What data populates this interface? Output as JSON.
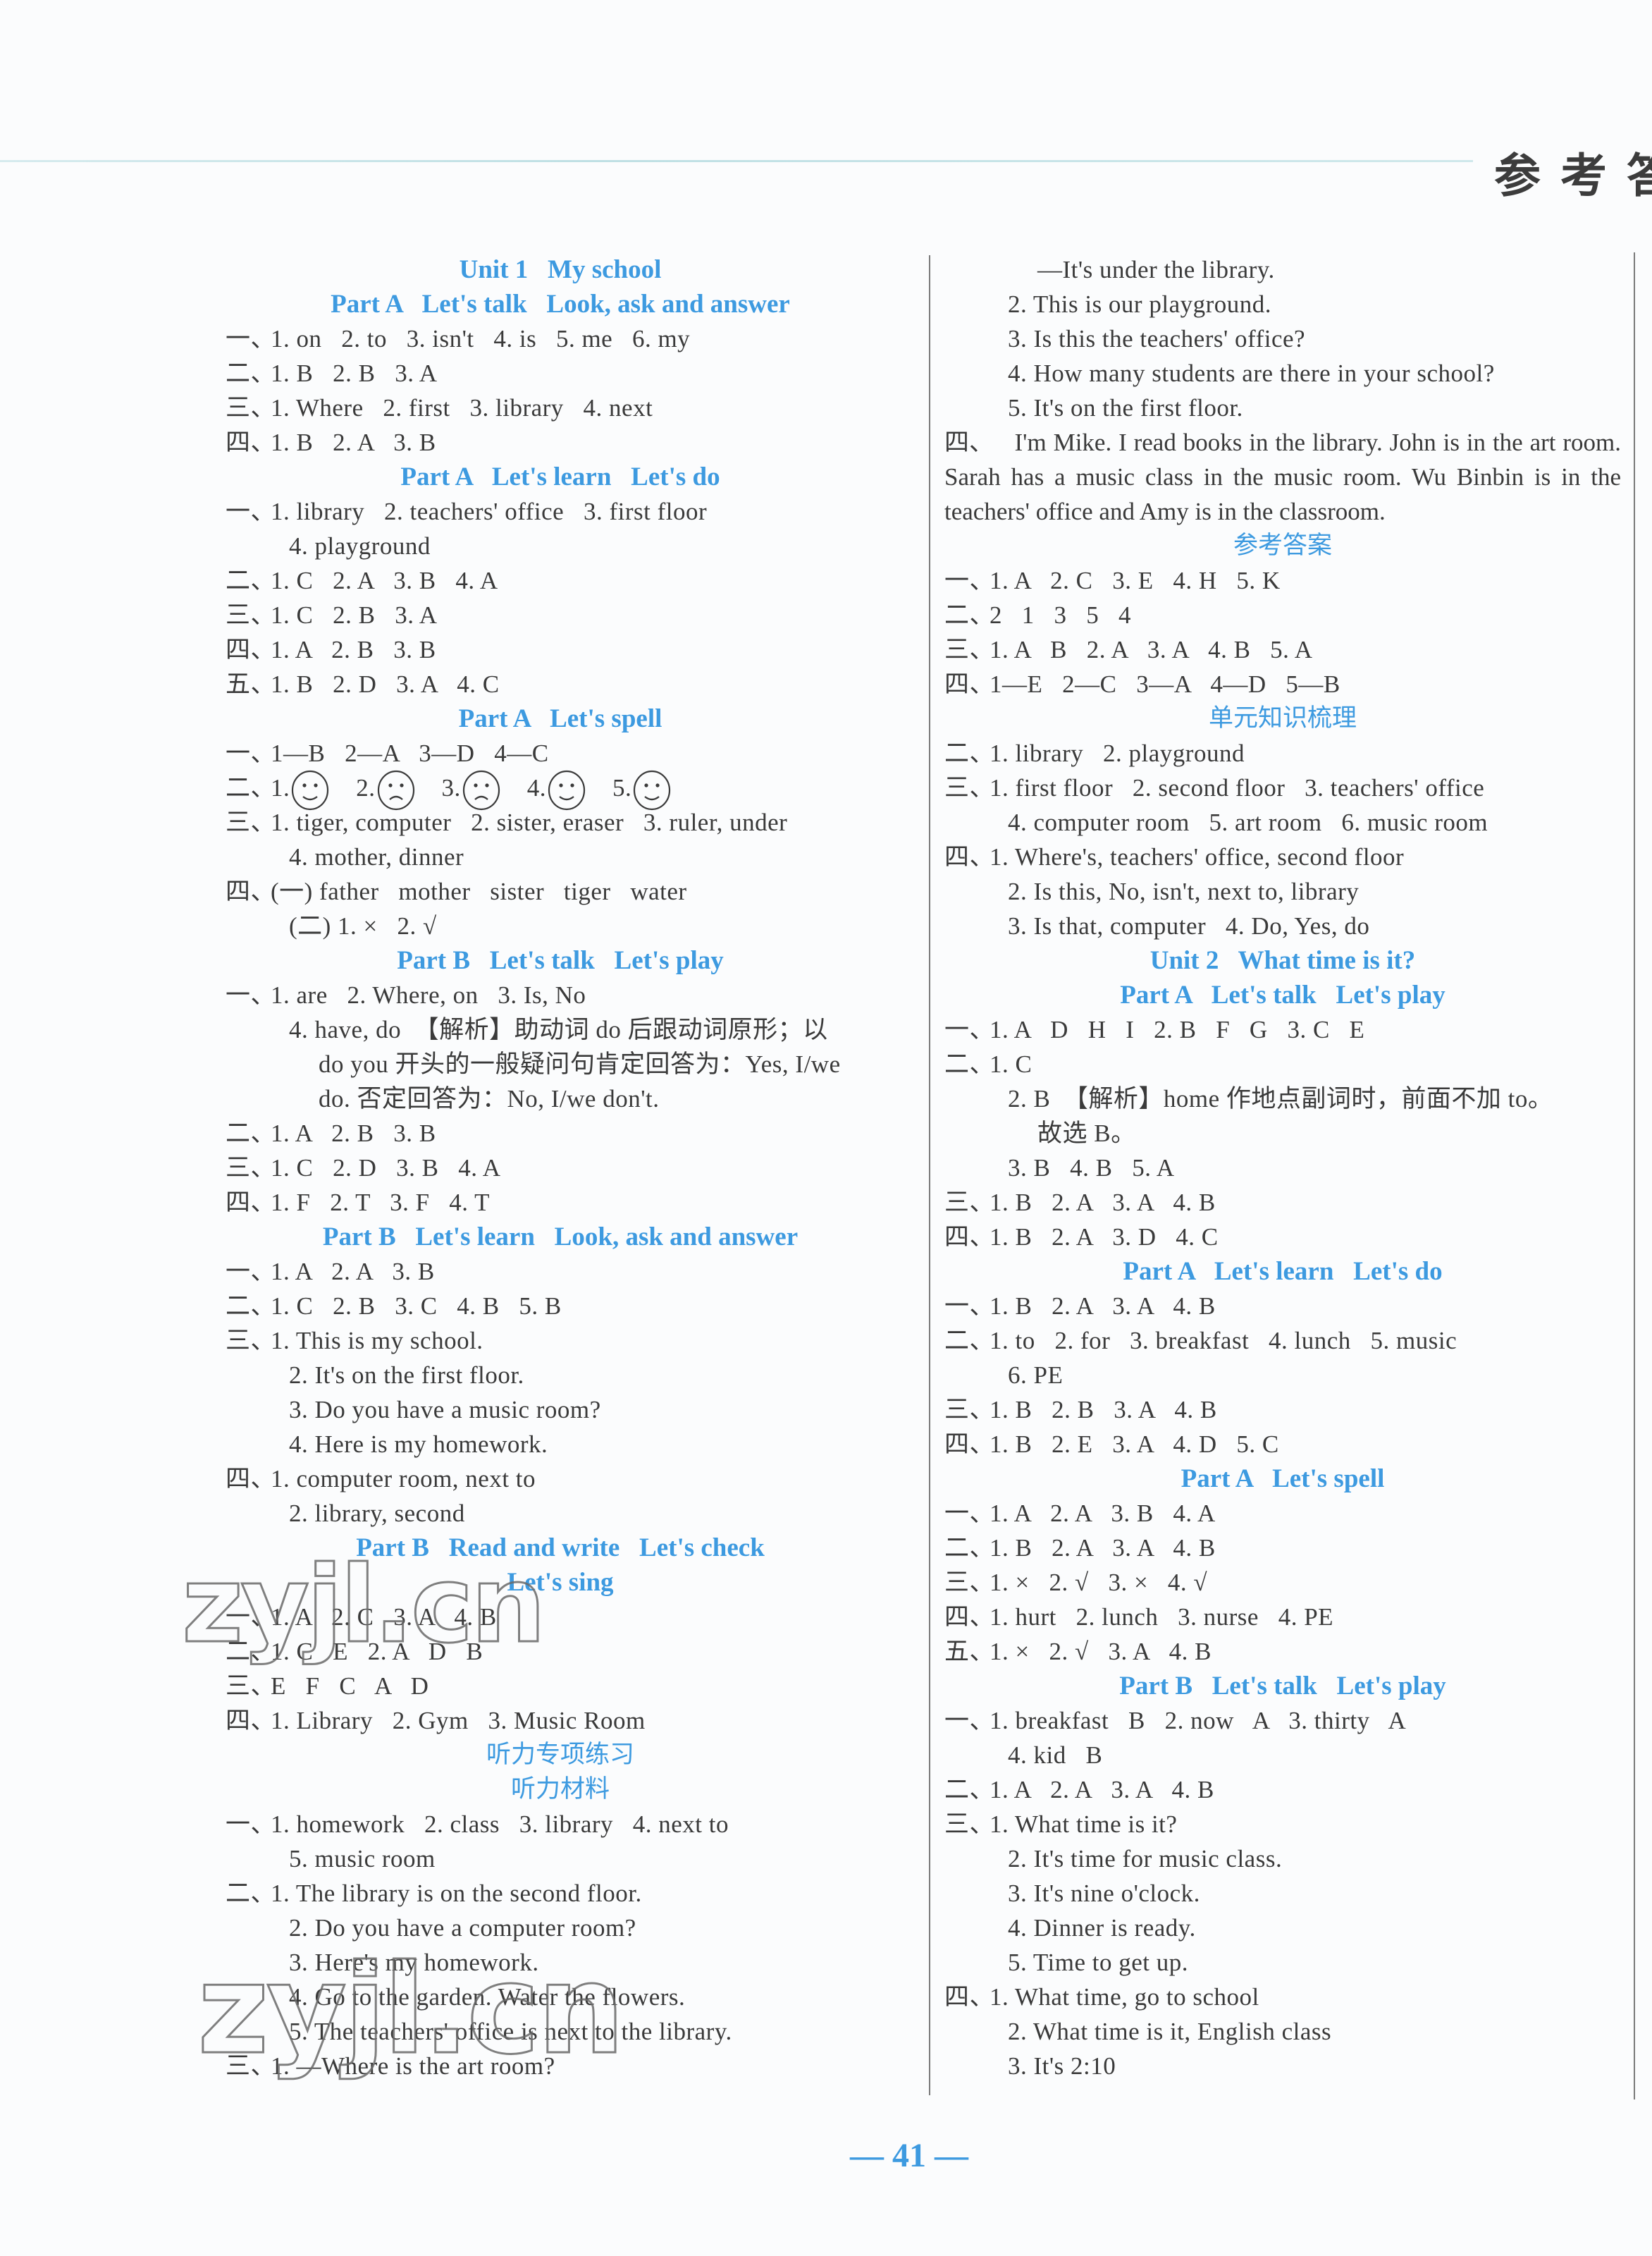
{
  "header": {
    "title": "参考答案"
  },
  "colors": {
    "heading": "#3d9ae0",
    "text": "#3a3a3a"
  },
  "left_column": [
    {
      "type": "heading",
      "text": "Unit 1   My school"
    },
    {
      "type": "heading",
      "text": "Part A   Let's talk   Look, ask and answer"
    },
    {
      "type": "line",
      "mark": "一、",
      "text": "1. on   2. to   3. isn't   4. is   5. me   6. my"
    },
    {
      "type": "line",
      "mark": "二、",
      "text": "1. B   2. B   3. A"
    },
    {
      "type": "line",
      "mark": "三、",
      "text": "1. Where   2. first   3. library   4. next"
    },
    {
      "type": "line",
      "mark": "四、",
      "text": "1. B   2. A   3. B"
    },
    {
      "type": "heading",
      "text": "Part A   Let's learn   Let's do"
    },
    {
      "type": "line",
      "mark": "一、",
      "text": "1. library   2. teachers' office   3. first floor"
    },
    {
      "type": "cont",
      "text": "4. playground"
    },
    {
      "type": "line",
      "mark": "二、",
      "text": "1. C   2. A   3. B   4. A"
    },
    {
      "type": "line",
      "mark": "三、",
      "text": "1. C   2. B   3. A"
    },
    {
      "type": "line",
      "mark": "四、",
      "text": "1. A   2. B   3. B"
    },
    {
      "type": "line",
      "mark": "五、",
      "text": "1. B   2. D   3. A   4. C"
    },
    {
      "type": "heading",
      "text": "Part A   Let's spell"
    },
    {
      "type": "line",
      "mark": "一、",
      "text": "1—B   2—A   3—D   4—C"
    },
    {
      "type": "faces",
      "mark": "二、",
      "items": [
        {
          "n": "1.",
          "face": "happy"
        },
        {
          "n": "2.",
          "face": "sad"
        },
        {
          "n": "3.",
          "face": "sad"
        },
        {
          "n": "4.",
          "face": "happy"
        },
        {
          "n": "5.",
          "face": "happy"
        }
      ]
    },
    {
      "type": "line",
      "mark": "三、",
      "text": "1. tiger, computer   2. sister, eraser   3. ruler, under"
    },
    {
      "type": "cont",
      "text": "4. mother, dinner"
    },
    {
      "type": "line",
      "mark": "四、",
      "text": "(一) father   mother   sister   tiger   water"
    },
    {
      "type": "cont",
      "text": "(二) 1. ×   2. √"
    },
    {
      "type": "heading",
      "text": "Part B   Let's talk   Let's play"
    },
    {
      "type": "line",
      "mark": "一、",
      "text": "1. are   2. Where, on   3. Is, No"
    },
    {
      "type": "cont",
      "text": "4. have, do  【解析】助动词 do 后跟动词原形；以"
    },
    {
      "type": "cont2",
      "text": "do you 开头的一般疑问句肯定回答为：Yes, I/we"
    },
    {
      "type": "cont2",
      "text": "do. 否定回答为：No, I/we don't."
    },
    {
      "type": "line",
      "mark": "二、",
      "text": "1. A   2. B   3. B"
    },
    {
      "type": "line",
      "mark": "三、",
      "text": "1. C   2. D   3. B   4. A"
    },
    {
      "type": "line",
      "mark": "四、",
      "text": "1. F   2. T   3. F   4. T"
    },
    {
      "type": "heading",
      "text": "Part B   Let's learn   Look, ask and answer"
    },
    {
      "type": "line",
      "mark": "一、",
      "text": "1. A   2. A   3. B"
    },
    {
      "type": "line",
      "mark": "二、",
      "text": "1. C   2. B   3. C   4. B   5. B"
    },
    {
      "type": "line",
      "mark": "三、",
      "text": "1. This is my school."
    },
    {
      "type": "cont",
      "text": "2. It's on the first floor."
    },
    {
      "type": "cont",
      "text": "3. Do you have a music room?"
    },
    {
      "type": "cont",
      "text": "4. Here is my homework."
    },
    {
      "type": "line",
      "mark": "四、",
      "text": "1. computer room, next to"
    },
    {
      "type": "cont",
      "text": "2. library, second"
    },
    {
      "type": "heading",
      "text": "Part B   Read and write   Let's check"
    },
    {
      "type": "heading",
      "text": "Let's sing"
    },
    {
      "type": "line",
      "mark": "一、",
      "text": "1. A   2. C   3. A   4. B"
    },
    {
      "type": "line",
      "mark": "二、",
      "text": "1. C   E   2. A   D   B"
    },
    {
      "type": "line",
      "mark": "三、",
      "text": "E   F   C   A   D"
    },
    {
      "type": "line",
      "mark": "四、",
      "text": "1. Library   2. Gym   3. Music Room"
    },
    {
      "type": "heading-cn",
      "text": "听力专项练习"
    },
    {
      "type": "heading-cn",
      "text": "听力材料"
    },
    {
      "type": "line",
      "mark": "一、",
      "text": "1. homework   2. class   3. library   4. next to"
    },
    {
      "type": "cont",
      "text": "5. music room"
    },
    {
      "type": "line",
      "mark": "二、",
      "text": "1. The library is on the second floor."
    },
    {
      "type": "cont",
      "text": "2. Do you have a computer room?"
    },
    {
      "type": "cont",
      "text": "3. Here's my homework."
    },
    {
      "type": "cont",
      "text": "4. Go to the garden. Water the flowers."
    },
    {
      "type": "cont",
      "text": "5. The teachers' office is next to the library."
    },
    {
      "type": "line",
      "mark": "三、",
      "text": "1. —Where is the art room?"
    }
  ],
  "right_column": [
    {
      "type": "cont2",
      "text": "—It's under the library."
    },
    {
      "type": "cont",
      "text": "2. This is our playground."
    },
    {
      "type": "cont",
      "text": "3. Is this the teachers' office?"
    },
    {
      "type": "cont",
      "text": "4. How many students are there in your school?"
    },
    {
      "type": "cont",
      "text": "5. It's on the first floor."
    },
    {
      "type": "para",
      "mark": "四、",
      "text": "    I'm Mike. I read books in the library. John is in the art room. Sarah has a music class in the music room. Wu Binbin is in the teachers' office and Amy is in the classroom."
    },
    {
      "type": "heading-cn",
      "text": "参考答案"
    },
    {
      "type": "line",
      "mark": "一、",
      "text": "1. A   2. C   3. E   4. H   5. K"
    },
    {
      "type": "line",
      "mark": "二、",
      "text": "2   1   3   5   4"
    },
    {
      "type": "line",
      "mark": "三、",
      "text": "1. A   B   2. A   3. A   4. B   5. A"
    },
    {
      "type": "line",
      "mark": "四、",
      "text": "1—E   2—C   3—A   4—D   5—B"
    },
    {
      "type": "heading-cn",
      "text": "单元知识梳理"
    },
    {
      "type": "line",
      "mark": "二、",
      "text": "1. library   2. playground"
    },
    {
      "type": "line",
      "mark": "三、",
      "text": "1. first floor   2. second floor   3. teachers' office"
    },
    {
      "type": "cont",
      "text": "4. computer room   5. art room   6. music room"
    },
    {
      "type": "line",
      "mark": "四、",
      "text": "1. Where's, teachers' office, second floor"
    },
    {
      "type": "cont",
      "text": "2. Is this, No, isn't, next to, library"
    },
    {
      "type": "cont",
      "text": "3. Is that, computer   4. Do, Yes, do"
    },
    {
      "type": "heading",
      "text": "Unit 2   What time is it?"
    },
    {
      "type": "heading",
      "text": "Part A   Let's talk   Let's play"
    },
    {
      "type": "line",
      "mark": "一、",
      "text": "1. A   D   H   I   2. B   F   G   3. C   E"
    },
    {
      "type": "line",
      "mark": "二、",
      "text": "1. C"
    },
    {
      "type": "cont",
      "text": "2. B  【解析】home 作地点副词时，前面不加 to。"
    },
    {
      "type": "cont2",
      "text": "故选 B。"
    },
    {
      "type": "cont",
      "text": "3. B   4. B   5. A"
    },
    {
      "type": "line",
      "mark": "三、",
      "text": "1. B   2. A   3. A   4. B"
    },
    {
      "type": "line",
      "mark": "四、",
      "text": "1. B   2. A   3. D   4. C"
    },
    {
      "type": "heading",
      "text": "Part A   Let's learn   Let's do"
    },
    {
      "type": "line",
      "mark": "一、",
      "text": "1. B   2. A   3. A   4. B"
    },
    {
      "type": "line",
      "mark": "二、",
      "text": "1. to   2. for   3. breakfast   4. lunch   5. music"
    },
    {
      "type": "cont",
      "text": "6. PE"
    },
    {
      "type": "line",
      "mark": "三、",
      "text": "1. B   2. B   3. A   4. B"
    },
    {
      "type": "line",
      "mark": "四、",
      "text": "1. B   2. E   3. A   4. D   5. C"
    },
    {
      "type": "heading",
      "text": "Part A   Let's spell"
    },
    {
      "type": "line",
      "mark": "一、",
      "text": "1. A   2. A   3. B   4. A"
    },
    {
      "type": "line",
      "mark": "二、",
      "text": "1. B   2. A   3. A   4. B"
    },
    {
      "type": "line",
      "mark": "三、",
      "text": "1. ×   2. √   3. ×   4. √"
    },
    {
      "type": "line",
      "mark": "四、",
      "text": "1. hurt   2. lunch   3. nurse   4. PE"
    },
    {
      "type": "line",
      "mark": "五、",
      "text": "1. ×   2. √   3. A   4. B"
    },
    {
      "type": "heading",
      "text": "Part B   Let's talk   Let's play"
    },
    {
      "type": "line",
      "mark": "一、",
      "text": "1. breakfast   B   2. now   A   3. thirty   A"
    },
    {
      "type": "cont",
      "text": "4. kid   B"
    },
    {
      "type": "line",
      "mark": "二、",
      "text": "1. A   2. A   3. A   4. B"
    },
    {
      "type": "line",
      "mark": "三、",
      "text": "1. What time is it?"
    },
    {
      "type": "cont",
      "text": "2. It's time for music class."
    },
    {
      "type": "cont",
      "text": "3. It's nine o'clock."
    },
    {
      "type": "cont",
      "text": "4. Dinner is ready."
    },
    {
      "type": "cont",
      "text": "5. Time to get up."
    },
    {
      "type": "line",
      "mark": "四、",
      "text": "1. What time, go to school"
    },
    {
      "type": "cont",
      "text": "2. What time is it, English class"
    },
    {
      "type": "cont",
      "text": "3. It's 2:10"
    }
  ],
  "watermark": {
    "text": "zyjl.cn"
  },
  "footer": {
    "page_number": "— 41 —"
  }
}
